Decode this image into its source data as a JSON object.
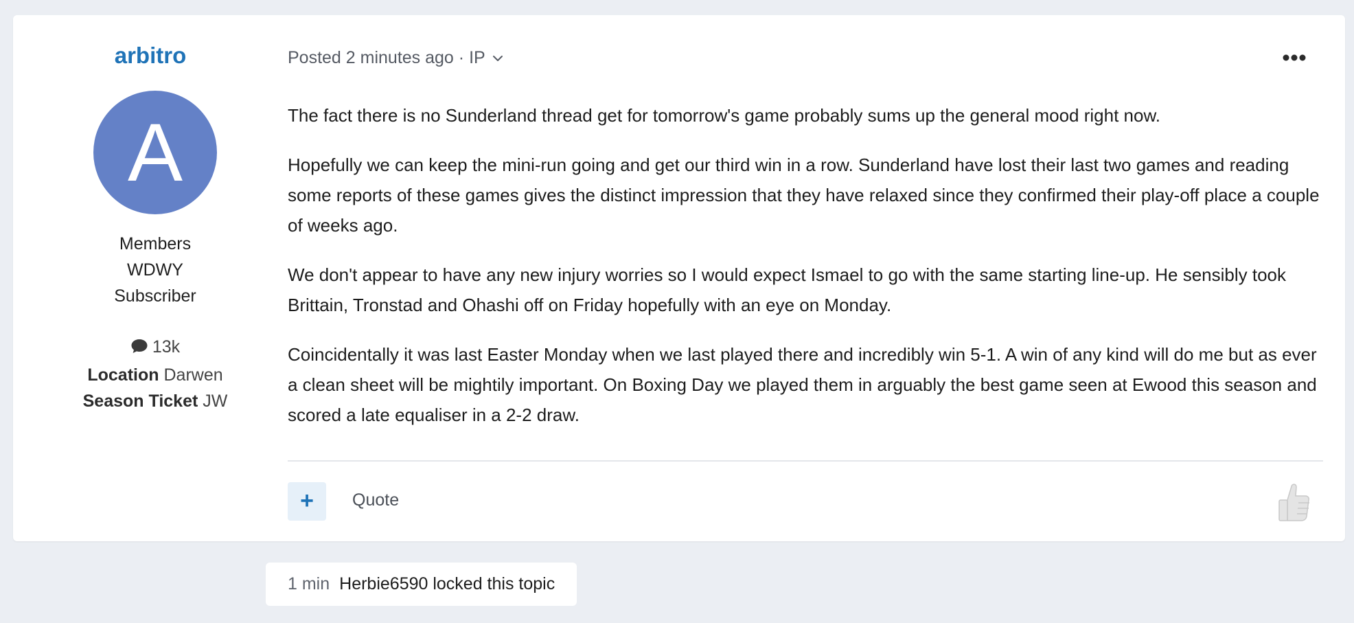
{
  "author": {
    "name": "arbitro",
    "avatar_letter": "A",
    "avatar_color": "#6481c7",
    "group": [
      "Members",
      "WDWY",
      "Subscriber"
    ],
    "posts_count": "13k",
    "location_label": "Location",
    "location_value": "Darwen",
    "season_ticket_label": "Season Ticket",
    "season_ticket_value": "JW"
  },
  "post": {
    "meta_posted": "Posted 2 minutes ago",
    "meta_separator": "·",
    "meta_ip": "IP",
    "paragraphs": [
      "The fact there is no Sunderland thread get for tomorrow's game probably sums up the general mood right now.",
      "Hopefully we can keep the mini-run going and get our third win in a row. Sunderland have lost their last two games and reading some reports of these games gives the distinct impression that they have relaxed since they confirmed their play-off place a couple of weeks ago.",
      "We don't appear to have any new injury worries so I would expect Ismael to go with the same starting line-up. He sensibly took Brittain, Tronstad and Ohashi off on Friday hopefully with an eye on Monday.",
      "Coincidentally it was last Easter Monday when we last played there and incredibly win 5-1. A win of any kind will do me but as ever a clean sheet will be mightily important. On Boxing Day we played them in arguably the best game seen at Ewood this season and scored a late equaliser in a 2-2 draw."
    ],
    "plus_label": "+",
    "quote_label": "Quote"
  },
  "event": {
    "time": "1 min",
    "text": "Herbie6590 locked this topic"
  },
  "colors": {
    "accent": "#1f73b7",
    "background": "#ebeef3"
  },
  "icons": {
    "comment": "comment-icon",
    "chevron": "chevron-down-icon",
    "more": "more-horizontal-icon",
    "reaction": "thumbs-up-icon"
  }
}
